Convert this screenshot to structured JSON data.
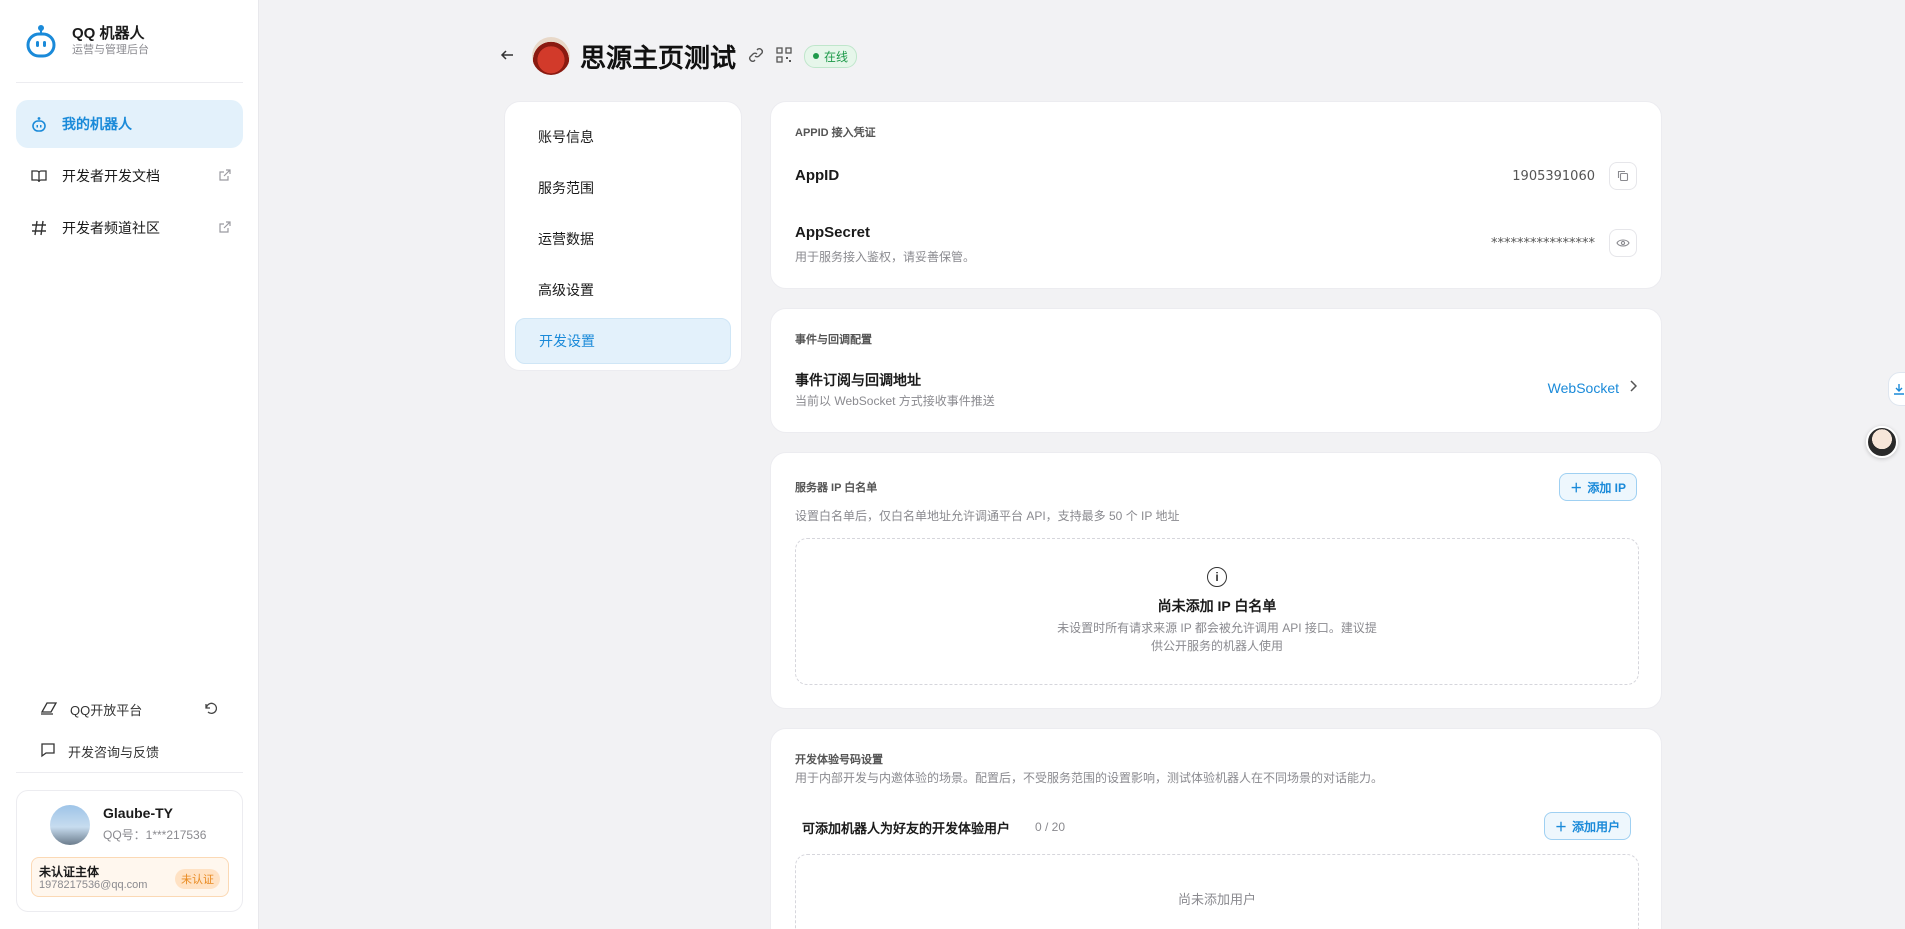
{
  "brand": {
    "title": "QQ 机器人",
    "subtitle": "运营与管理后台"
  },
  "nav": [
    {
      "label": "我的机器人",
      "icon": "robot-icon",
      "active": true,
      "external": false
    },
    {
      "label": "开发者开发文档",
      "icon": "book-icon",
      "active": false,
      "external": true
    },
    {
      "label": "开发者频道社区",
      "icon": "hash-icon",
      "active": false,
      "external": true
    }
  ],
  "bottom_links": [
    {
      "label": "QQ开放平台",
      "icon": "platform-icon",
      "trailing": "refresh-icon"
    },
    {
      "label": "开发咨询与反馈",
      "icon": "chat-icon"
    }
  ],
  "user": {
    "name": "Glaube-TY",
    "qq": "QQ号：1***217536",
    "cert_title": "未认证主体",
    "cert_email": "1978217536@qq.com",
    "cert_badge": "未认证"
  },
  "header": {
    "bot_name": "思源主页测试",
    "status": "在线"
  },
  "tabs": [
    {
      "label": "账号信息",
      "active": false
    },
    {
      "label": "服务范围",
      "active": false
    },
    {
      "label": "运营数据",
      "active": false
    },
    {
      "label": "高级设置",
      "active": false
    },
    {
      "label": "开发设置",
      "active": true
    }
  ],
  "credentials": {
    "label": "APPID 接入凭证",
    "appid_title": "AppID",
    "appid_value": "1905391060",
    "secret_title": "AppSecret",
    "secret_desc": "用于服务接入鉴权，请妥善保管。",
    "secret_value": "****************"
  },
  "events": {
    "label": "事件与回调配置",
    "title": "事件订阅与回调地址",
    "desc": "当前以 WebSocket 方式接收事件推送",
    "value": "WebSocket"
  },
  "whitelist": {
    "label": "服务器 IP 白名单",
    "desc": "设置白名单后，仅白名单地址允许调通平台 API，支持最多 50 个 IP 地址",
    "add_button": "添加 IP",
    "empty_title": "尚未添加 IP 白名单",
    "empty_desc": "未设置时所有请求来源 IP 都会被允许调用 API 接口。建议提供公开服务的机器人使用"
  },
  "testers": {
    "label": "开发体验号码设置",
    "desc": "用于内部开发与内邀体验的场景。配置后，不受服务范围的设置影响，测试体验机器人在不同场景的对话能力。",
    "subtitle": "可添加机器人为好友的开发体验用户",
    "count": "0 / 20",
    "add_button": "添加用户",
    "empty": "尚未添加用户"
  },
  "colors": {
    "accent": "#1a8ad9",
    "online": "#1e9a4a",
    "warning": "#e8891f"
  }
}
